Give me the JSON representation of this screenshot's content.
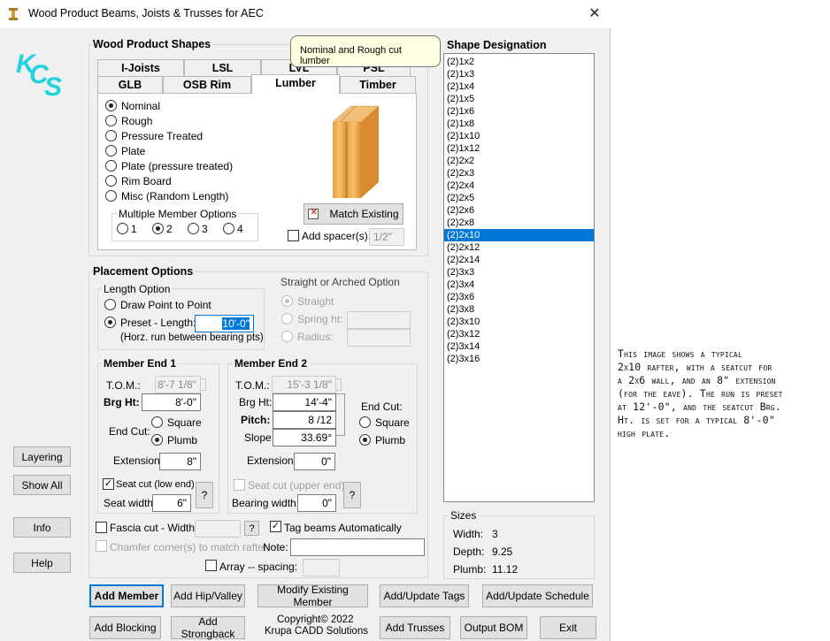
{
  "window": {
    "title": "Wood Product Beams, Joists & Trusses for AEC",
    "close_glyph": "✕"
  },
  "logo": {
    "letters": [
      "K",
      "C",
      "S"
    ],
    "color": "#22d3e0"
  },
  "shapes": {
    "title": "Wood Product Shapes",
    "tabs_row1": [
      "I-Joists",
      "LSL",
      "LVL",
      "PSL"
    ],
    "tabs_row2": [
      "GLB",
      "OSB Rim",
      "Lumber",
      "Timber"
    ],
    "selected_tab": "Lumber",
    "tooltip": "Nominal and Rough cut lumber",
    "types": [
      "Nominal",
      "Rough",
      "Pressure Treated",
      "Plate",
      "Plate (pressure treated)",
      "Rim Board",
      "Misc (Random Length)"
    ],
    "selected_type": "Nominal",
    "multiple_label": "Multiple Member Options",
    "multiple_options": [
      "1",
      "2",
      "3",
      "4"
    ],
    "multiple_selected": "2",
    "match_button": "Match Existing",
    "spacer_label": "Add spacer(s):",
    "spacer_value": "1/2\""
  },
  "designation": {
    "title": "Shape Designation",
    "items": [
      "(2)1x2",
      "(2)1x3",
      "(2)1x4",
      "(2)1x5",
      "(2)1x6",
      "(2)1x8",
      "(2)1x10",
      "(2)1x12",
      "(2)2x2",
      "(2)2x3",
      "(2)2x4",
      "(2)2x5",
      "(2)2x6",
      "(2)2x8",
      "(2)2x10",
      "(2)2x12",
      "(2)2x14",
      "(2)3x3",
      "(2)3x4",
      "(2)3x6",
      "(2)3x8",
      "(2)3x10",
      "(2)3x12",
      "(2)3x14",
      "(2)3x16"
    ],
    "selected": "(2)2x10"
  },
  "placement": {
    "title": "Placement Options",
    "length_option": {
      "title": "Length Option",
      "draw": "Draw Point to Point",
      "preset": "Preset - Length:",
      "preset_value": "10'-0\"",
      "note": "(Horz. run  between bearing pts)"
    },
    "arched": {
      "title": "Straight or Arched Option",
      "straight": "Straight",
      "spring": "Spring ht:",
      "radius": "Radius:"
    }
  },
  "end1": {
    "title": "Member End 1",
    "tom_label": "T.O.M.:",
    "tom_value": "8'-7 1/8\"",
    "brg_label": "Brg Ht:",
    "brg_value": "8'-0\"",
    "endcut_label": "End Cut:",
    "square": "Square",
    "plumb": "Plumb",
    "ext_label": "Extension:",
    "ext_value": "8\"",
    "seat_label": "Seat cut (low end)",
    "seatw_label": "Seat width:",
    "seatw_value": "6\"",
    "help": "?"
  },
  "end2": {
    "title": "Member End 2",
    "tom_label": "T.O.M.:",
    "tom_value": "15'-3 1/8\"",
    "brg_label": "Brg Ht:",
    "brg_value": "14'-4\"",
    "pitch_label": "Pitch:",
    "pitch_value": "8 /12",
    "slope_label": "Slope:",
    "slope_value": "33.69°",
    "endcut_label": "End Cut:",
    "square": "Square",
    "plumb": "Plumb",
    "ext_label": "Extension:",
    "ext_value": "0\"",
    "seat_label": "Seat cut (upper end)",
    "bearing_label": "Bearing width:",
    "bearing_value": "0\"",
    "help": "?"
  },
  "options": {
    "fascia": "Fascia cut - Width:",
    "fascia_help": "?",
    "tag": "Tag beams Automatically",
    "chamfer": "Chamfer corner(s) to match rafter",
    "note_label": "Note:",
    "array": "Array -- spacing:"
  },
  "sizes": {
    "title": "Sizes",
    "width_label": "Width:",
    "width_value": "3",
    "depth_label": "Depth:",
    "depth_value": "9.25",
    "plumb_label": "Plumb:",
    "plumb_value": "11.12"
  },
  "side_buttons": [
    "Layering",
    "Show All",
    "Info",
    "Help"
  ],
  "bottom_row1": [
    "Add Member",
    "Add Hip/Valley",
    "Modify Existing Member",
    "Add/Update Tags",
    "Add/Update Schedule"
  ],
  "bottom_row2": [
    "Add Blocking",
    "Add Strongback",
    "Add Trusses",
    "Output BOM",
    "Exit"
  ],
  "copyright": {
    "line1": "Copyright© 2022",
    "line2": "Krupa CADD Solutions"
  },
  "caption_lines": [
    "This image shows a typical",
    "2x10 rafter, with a seatcut for",
    "a 2x6 wall, and an 8\" extension",
    "(for the eave). The run is preset",
    "at 12'-0\", and the seatcut Brg.",
    "Ht. is set for a typical 8'-0\"",
    "high plate."
  ]
}
